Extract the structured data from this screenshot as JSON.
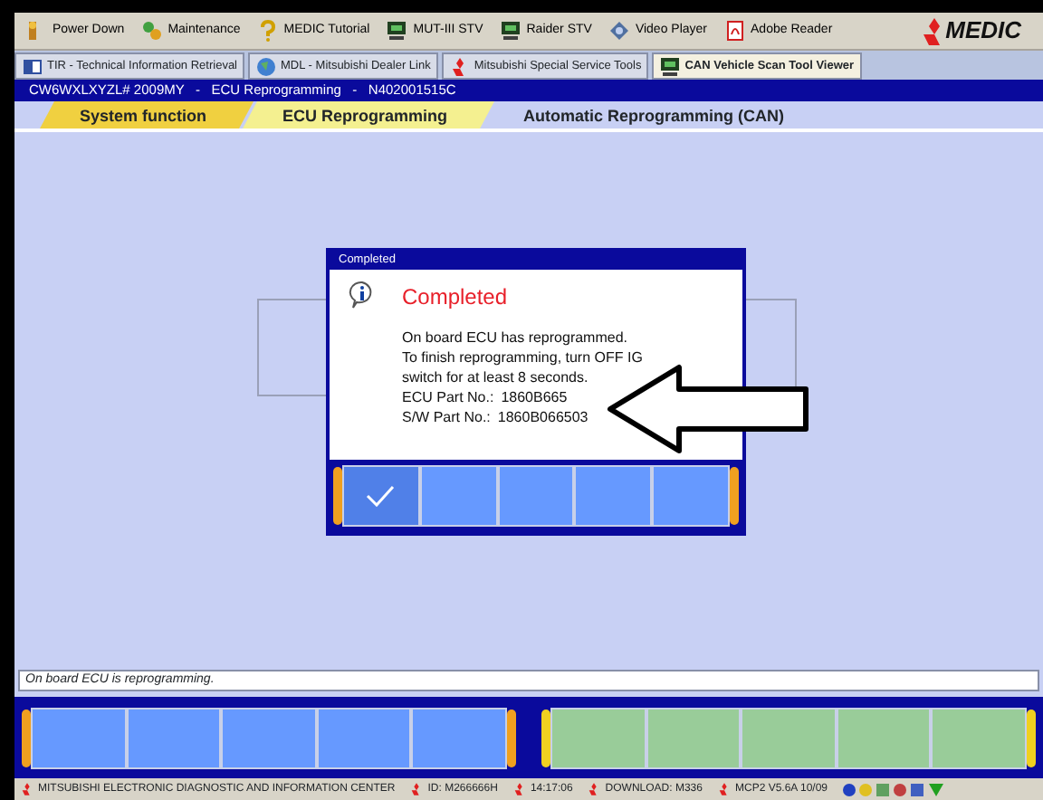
{
  "toolbar": {
    "items": [
      {
        "label": "Power Down",
        "kind": "power"
      },
      {
        "label": "Maintenance",
        "kind": "maint"
      },
      {
        "label": "MEDIC Tutorial",
        "kind": "help"
      },
      {
        "label": "MUT-III STV",
        "kind": "pc"
      },
      {
        "label": "Raider STV",
        "kind": "pc"
      },
      {
        "label": "Video Player",
        "kind": "video"
      },
      {
        "label": "Adobe Reader",
        "kind": "pdf"
      }
    ],
    "logo": "MEDIC"
  },
  "app_tabs": [
    {
      "label": "TIR - Technical Information Retrieval",
      "selected": false,
      "kind": "book"
    },
    {
      "label": "MDL - Mitsubishi Dealer Link",
      "selected": false,
      "kind": "globe"
    },
    {
      "label": "Mitsubishi Special Service Tools",
      "selected": false,
      "kind": "brand"
    },
    {
      "label": "CAN Vehicle Scan Tool Viewer",
      "selected": true,
      "kind": "pc"
    }
  ],
  "title_bar": "CW6WXLXYZL# 2009MY   -   ECU Reprogramming   -   N402001515C",
  "breadcrumbs": [
    {
      "label": "System function",
      "selected": false
    },
    {
      "label": "ECU Reprogramming",
      "selected": false
    },
    {
      "label": "Automatic Reprogramming (CAN)",
      "selected": true
    }
  ],
  "dialog": {
    "title": "Completed",
    "heading": "Completed",
    "message": [
      "On board ECU has reprogrammed.",
      "To finish reprogramming, turn OFF IG",
      "switch for at least 8 seconds."
    ],
    "fields": [
      {
        "label": "ECU Part No.:",
        "value": "1860B665"
      },
      {
        "label": "S/W Part No.:",
        "value": "1860B066503"
      }
    ],
    "keys": [
      {
        "kind": "check"
      },
      {
        "kind": "blank"
      },
      {
        "kind": "blank"
      },
      {
        "kind": "blank"
      },
      {
        "kind": "blank"
      }
    ]
  },
  "status_message": "On board ECU is reprogramming.",
  "key_bars": [
    {
      "keys": [
        {
          "disabled": false
        },
        {
          "disabled": false
        },
        {
          "disabled": false
        },
        {
          "disabled": false
        },
        {
          "disabled": false
        }
      ]
    },
    {
      "keys": [
        {
          "disabled": true
        },
        {
          "disabled": true
        },
        {
          "disabled": true
        },
        {
          "disabled": true
        },
        {
          "disabled": true
        }
      ]
    }
  ],
  "status_bar": [
    {
      "text": "MITSUBISHI ELECTRONIC DIAGNOSTIC AND INFORMATION CENTER"
    },
    {
      "text": "ID: M266666H"
    },
    {
      "text": "14:17:06"
    },
    {
      "text": "DOWNLOAD: M336"
    },
    {
      "text": "MCP2 V5.6A 10/09"
    }
  ]
}
